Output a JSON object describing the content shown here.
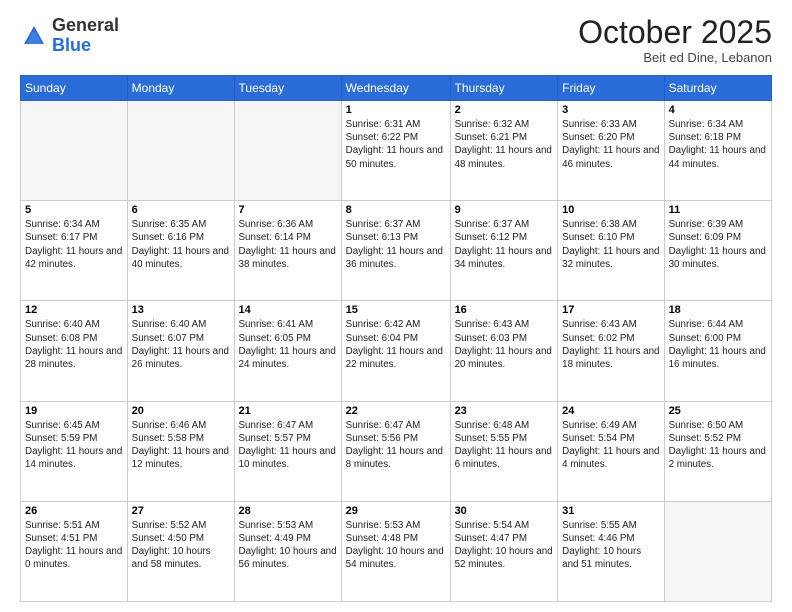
{
  "header": {
    "logo_general": "General",
    "logo_blue": "Blue",
    "title": "October 2025",
    "subtitle": "Beit ed Dine, Lebanon"
  },
  "days_of_week": [
    "Sunday",
    "Monday",
    "Tuesday",
    "Wednesday",
    "Thursday",
    "Friday",
    "Saturday"
  ],
  "weeks": [
    {
      "shaded": false,
      "days": [
        {
          "date": "",
          "info": ""
        },
        {
          "date": "",
          "info": ""
        },
        {
          "date": "",
          "info": ""
        },
        {
          "date": "1",
          "info": "Sunrise: 6:31 AM\nSunset: 6:22 PM\nDaylight: 11 hours\nand 50 minutes."
        },
        {
          "date": "2",
          "info": "Sunrise: 6:32 AM\nSunset: 6:21 PM\nDaylight: 11 hours\nand 48 minutes."
        },
        {
          "date": "3",
          "info": "Sunrise: 6:33 AM\nSunset: 6:20 PM\nDaylight: 11 hours\nand 46 minutes."
        },
        {
          "date": "4",
          "info": "Sunrise: 6:34 AM\nSunset: 6:18 PM\nDaylight: 11 hours\nand 44 minutes."
        }
      ]
    },
    {
      "shaded": true,
      "days": [
        {
          "date": "5",
          "info": "Sunrise: 6:34 AM\nSunset: 6:17 PM\nDaylight: 11 hours\nand 42 minutes."
        },
        {
          "date": "6",
          "info": "Sunrise: 6:35 AM\nSunset: 6:16 PM\nDaylight: 11 hours\nand 40 minutes."
        },
        {
          "date": "7",
          "info": "Sunrise: 6:36 AM\nSunset: 6:14 PM\nDaylight: 11 hours\nand 38 minutes."
        },
        {
          "date": "8",
          "info": "Sunrise: 6:37 AM\nSunset: 6:13 PM\nDaylight: 11 hours\nand 36 minutes."
        },
        {
          "date": "9",
          "info": "Sunrise: 6:37 AM\nSunset: 6:12 PM\nDaylight: 11 hours\nand 34 minutes."
        },
        {
          "date": "10",
          "info": "Sunrise: 6:38 AM\nSunset: 6:10 PM\nDaylight: 11 hours\nand 32 minutes."
        },
        {
          "date": "11",
          "info": "Sunrise: 6:39 AM\nSunset: 6:09 PM\nDaylight: 11 hours\nand 30 minutes."
        }
      ]
    },
    {
      "shaded": false,
      "days": [
        {
          "date": "12",
          "info": "Sunrise: 6:40 AM\nSunset: 6:08 PM\nDaylight: 11 hours\nand 28 minutes."
        },
        {
          "date": "13",
          "info": "Sunrise: 6:40 AM\nSunset: 6:07 PM\nDaylight: 11 hours\nand 26 minutes."
        },
        {
          "date": "14",
          "info": "Sunrise: 6:41 AM\nSunset: 6:05 PM\nDaylight: 11 hours\nand 24 minutes."
        },
        {
          "date": "15",
          "info": "Sunrise: 6:42 AM\nSunset: 6:04 PM\nDaylight: 11 hours\nand 22 minutes."
        },
        {
          "date": "16",
          "info": "Sunrise: 6:43 AM\nSunset: 6:03 PM\nDaylight: 11 hours\nand 20 minutes."
        },
        {
          "date": "17",
          "info": "Sunrise: 6:43 AM\nSunset: 6:02 PM\nDaylight: 11 hours\nand 18 minutes."
        },
        {
          "date": "18",
          "info": "Sunrise: 6:44 AM\nSunset: 6:00 PM\nDaylight: 11 hours\nand 16 minutes."
        }
      ]
    },
    {
      "shaded": true,
      "days": [
        {
          "date": "19",
          "info": "Sunrise: 6:45 AM\nSunset: 5:59 PM\nDaylight: 11 hours\nand 14 minutes."
        },
        {
          "date": "20",
          "info": "Sunrise: 6:46 AM\nSunset: 5:58 PM\nDaylight: 11 hours\nand 12 minutes."
        },
        {
          "date": "21",
          "info": "Sunrise: 6:47 AM\nSunset: 5:57 PM\nDaylight: 11 hours\nand 10 minutes."
        },
        {
          "date": "22",
          "info": "Sunrise: 6:47 AM\nSunset: 5:56 PM\nDaylight: 11 hours\nand 8 minutes."
        },
        {
          "date": "23",
          "info": "Sunrise: 6:48 AM\nSunset: 5:55 PM\nDaylight: 11 hours\nand 6 minutes."
        },
        {
          "date": "24",
          "info": "Sunrise: 6:49 AM\nSunset: 5:54 PM\nDaylight: 11 hours\nand 4 minutes."
        },
        {
          "date": "25",
          "info": "Sunrise: 6:50 AM\nSunset: 5:52 PM\nDaylight: 11 hours\nand 2 minutes."
        }
      ]
    },
    {
      "shaded": false,
      "days": [
        {
          "date": "26",
          "info": "Sunrise: 5:51 AM\nSunset: 4:51 PM\nDaylight: 11 hours\nand 0 minutes."
        },
        {
          "date": "27",
          "info": "Sunrise: 5:52 AM\nSunset: 4:50 PM\nDaylight: 10 hours\nand 58 minutes."
        },
        {
          "date": "28",
          "info": "Sunrise: 5:53 AM\nSunset: 4:49 PM\nDaylight: 10 hours\nand 56 minutes."
        },
        {
          "date": "29",
          "info": "Sunrise: 5:53 AM\nSunset: 4:48 PM\nDaylight: 10 hours\nand 54 minutes."
        },
        {
          "date": "30",
          "info": "Sunrise: 5:54 AM\nSunset: 4:47 PM\nDaylight: 10 hours\nand 52 minutes."
        },
        {
          "date": "31",
          "info": "Sunrise: 5:55 AM\nSunset: 4:46 PM\nDaylight: 10 hours\nand 51 minutes."
        },
        {
          "date": "",
          "info": ""
        }
      ]
    }
  ]
}
